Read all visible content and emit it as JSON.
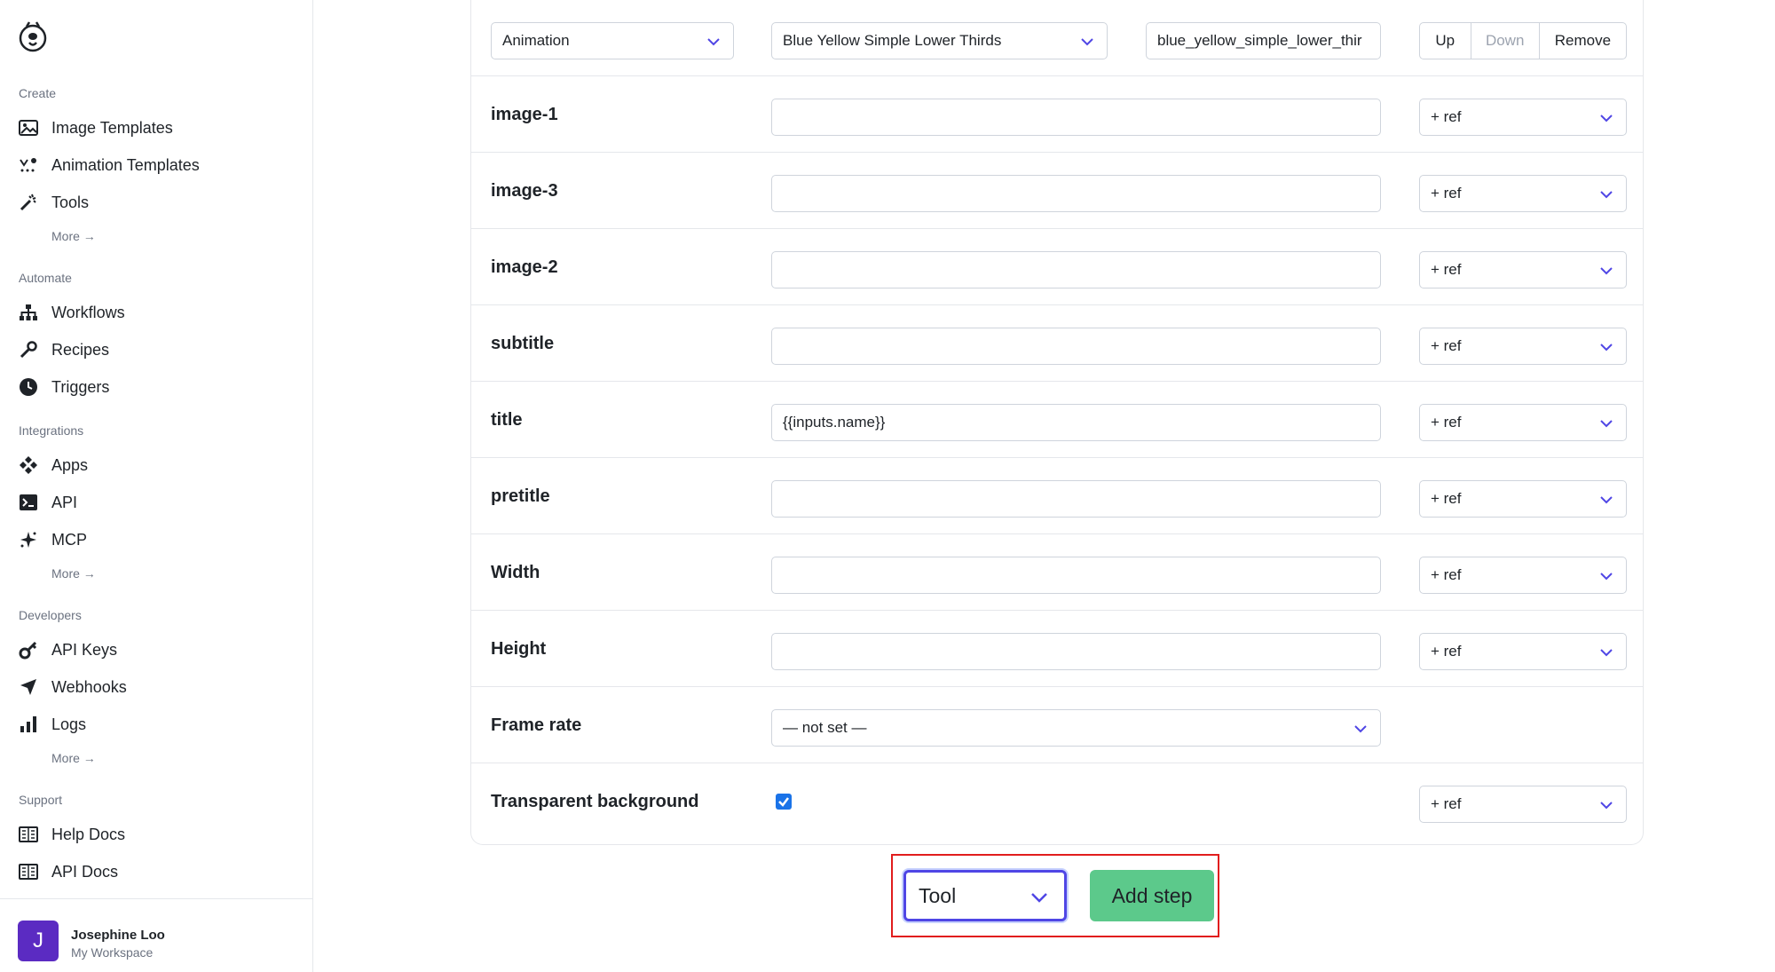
{
  "sidebar": {
    "sections": [
      {
        "title": "Create",
        "items": [
          {
            "label": "Image Templates",
            "icon": "image-icon"
          },
          {
            "label": "Animation Templates",
            "icon": "animation-icon"
          },
          {
            "label": "Tools",
            "icon": "magic-wand-icon"
          }
        ],
        "more": "More →"
      },
      {
        "title": "Automate",
        "items": [
          {
            "label": "Workflows",
            "icon": "workflow-icon"
          },
          {
            "label": "Recipes",
            "icon": "wrench-icon"
          },
          {
            "label": "Triggers",
            "icon": "clock-icon"
          }
        ]
      },
      {
        "title": "Integrations",
        "items": [
          {
            "label": "Apps",
            "icon": "apps-icon"
          },
          {
            "label": "API",
            "icon": "terminal-icon"
          },
          {
            "label": "MCP",
            "icon": "sparkle-icon"
          }
        ],
        "more": "More →"
      },
      {
        "title": "Developers",
        "items": [
          {
            "label": "API Keys",
            "icon": "key-icon"
          },
          {
            "label": "Webhooks",
            "icon": "send-icon"
          },
          {
            "label": "Logs",
            "icon": "bar-chart-icon"
          }
        ],
        "more": "More →"
      },
      {
        "title": "Support",
        "items": [
          {
            "label": "Help Docs",
            "icon": "book-icon"
          },
          {
            "label": "API Docs",
            "icon": "book-icon"
          }
        ]
      }
    ],
    "user": {
      "initial": "J",
      "name": "Josephine Loo",
      "workspace": "My Workspace"
    }
  },
  "step": {
    "type_select": "Animation",
    "template_select": "Blue Yellow Simple Lower Thirds",
    "template_id": "blue_yellow_simple_lower_thir",
    "up_label": "Up",
    "down_label": "Down",
    "remove_label": "Remove"
  },
  "ref_label": "+ ref",
  "fields": [
    {
      "label": "image-1",
      "value": ""
    },
    {
      "label": "image-3",
      "value": ""
    },
    {
      "label": "image-2",
      "value": ""
    },
    {
      "label": "subtitle",
      "value": ""
    },
    {
      "label": "title",
      "value": "{{inputs.name}}"
    },
    {
      "label": "pretitle",
      "value": ""
    },
    {
      "label": "Width",
      "value": ""
    },
    {
      "label": "Height",
      "value": ""
    }
  ],
  "frame_rate": {
    "label": "Frame rate",
    "value": "— not set —"
  },
  "transparent_bg": {
    "label": "Transparent background",
    "checked": true
  },
  "add_step": {
    "tool_select": "Tool",
    "button": "Add step"
  },
  "colors": {
    "accent": "#4f46e5",
    "add_step_button": "#5cc98b",
    "avatar": "#5b2bc2",
    "highlight_border": "#e11d1d",
    "checkbox": "#1a73e8"
  }
}
